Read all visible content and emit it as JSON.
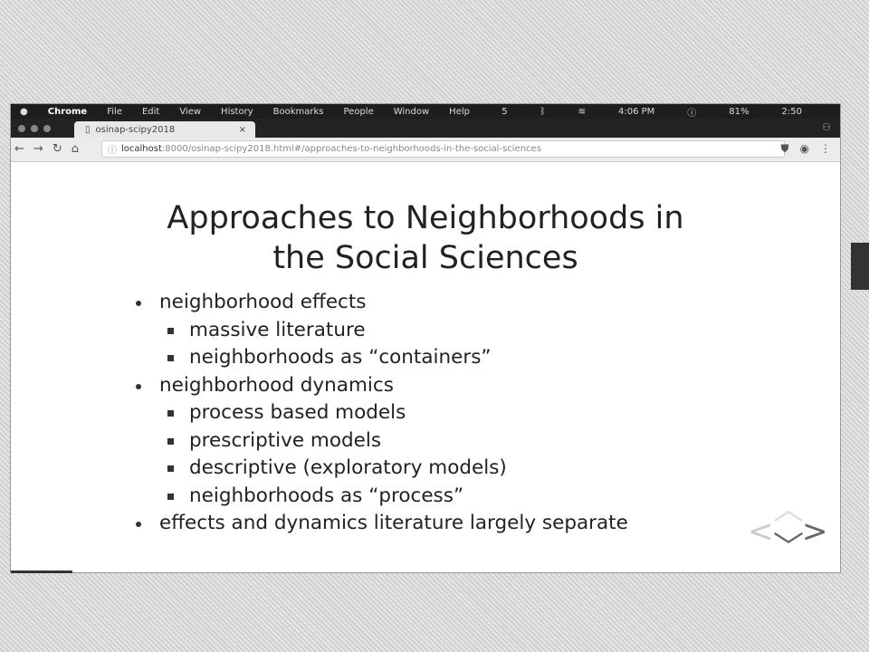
{
  "menubar": {
    "app": "Chrome",
    "items": [
      "File",
      "Edit",
      "View",
      "History",
      "Bookmarks",
      "People",
      "Window",
      "Help"
    ],
    "status": {
      "notifications": "5",
      "time": "4:06 PM",
      "battery": "81%",
      "clock2": "2:50"
    }
  },
  "tab": {
    "title": "osinap-scipy2018",
    "close": "×"
  },
  "address": {
    "host": "localhost",
    "rest": ":8000/osinap-scipy2018.html#/approaches-to-neighborhoods-in-the-social-sciences"
  },
  "slide": {
    "title_line1": "Approaches to Neighborhoods in",
    "title_line2": "the Social Sciences",
    "bullets": [
      {
        "level": 1,
        "text": "neighborhood effects"
      },
      {
        "level": 2,
        "text": "massive literature"
      },
      {
        "level": 2,
        "text": "neighborhoods as “containers”"
      },
      {
        "level": 1,
        "text": "neighborhood dynamics"
      },
      {
        "level": 2,
        "text": "process based models"
      },
      {
        "level": 2,
        "text": "prescriptive models"
      },
      {
        "level": 2,
        "text": "descriptive (exploratory models)"
      },
      {
        "level": 2,
        "text": "neighborhoods as “process”"
      },
      {
        "level": 1,
        "text": "effects and dynamics literature largely separate"
      }
    ]
  }
}
